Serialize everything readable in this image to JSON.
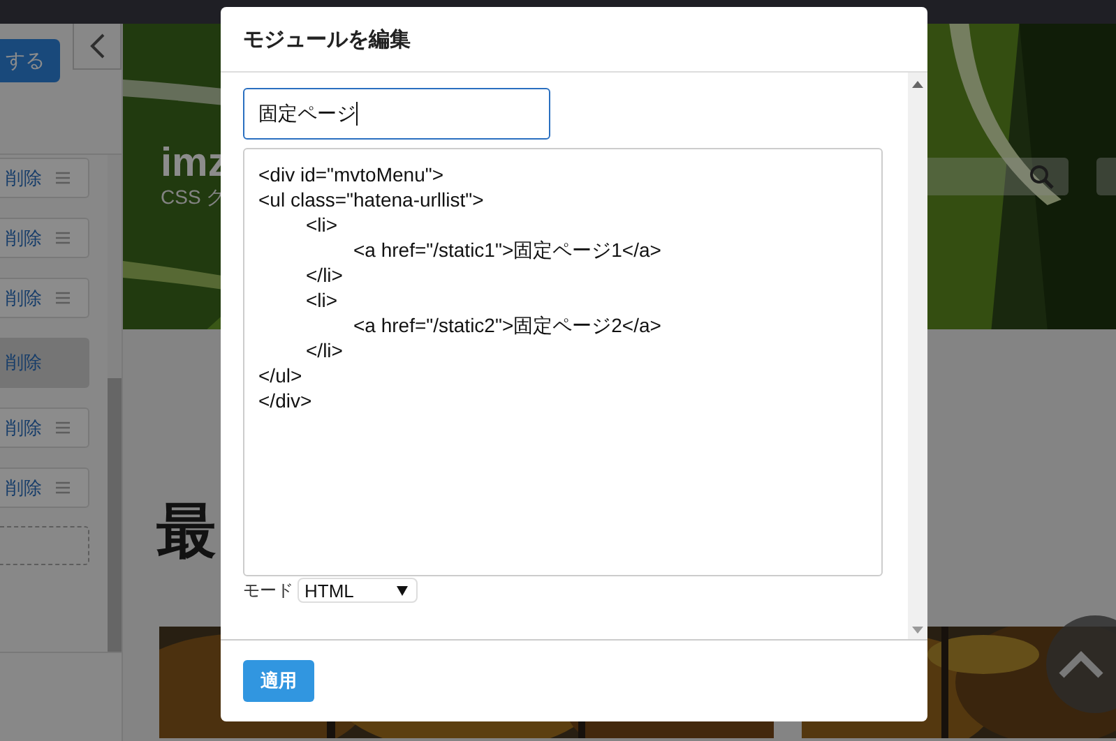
{
  "sidebar": {
    "save_button": "する",
    "items": [
      {
        "label": "削除",
        "selected": false
      },
      {
        "label": "削除",
        "selected": false
      },
      {
        "label": "削除",
        "selected": false
      },
      {
        "label": "削除",
        "selected": true
      },
      {
        "label": "削除",
        "selected": false
      },
      {
        "label": "削除",
        "selected": false
      }
    ]
  },
  "site": {
    "title": "imz",
    "subtitle": "CSS ク",
    "heading": "最"
  },
  "modal": {
    "title": "モジュールを編集",
    "name_value": "固定ページ",
    "code": "<div id=\"mvtoMenu\">\n<ul class=\"hatena-urllist\">\n\t<li>\n\t\t<a href=\"/static1\">固定ページ1</a>\n\t</li>\n\t<li>\n\t\t<a href=\"/static2\">固定ページ2</a>\n\t</li>\n</ul>\n</div>",
    "mode_label": "モード",
    "mode_value": "HTML",
    "apply_button": "適用"
  }
}
